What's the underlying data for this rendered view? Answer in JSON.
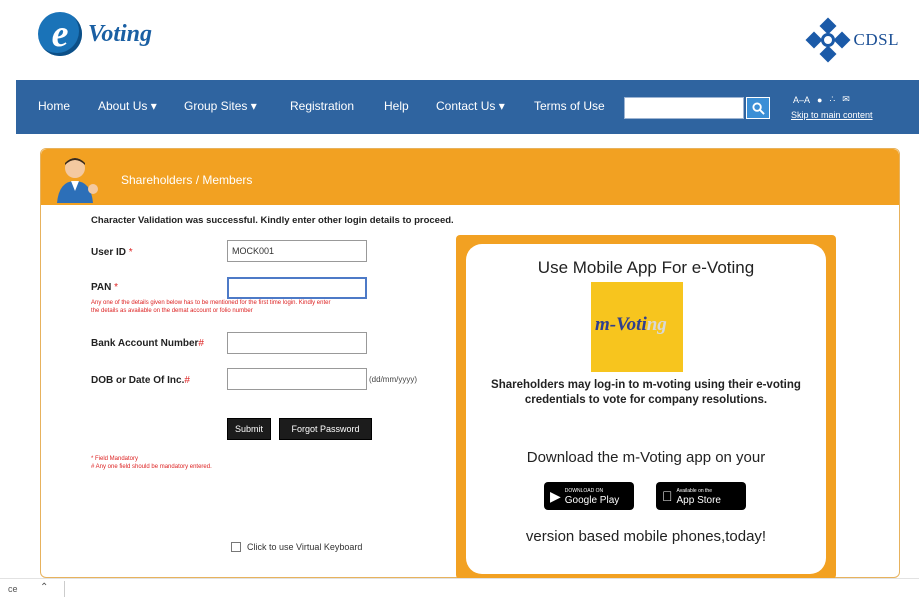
{
  "header": {
    "logo_letter": "e",
    "logo_text": "Voting",
    "partner_logo_text": "CDSL"
  },
  "nav": {
    "items": [
      {
        "label": "Home"
      },
      {
        "label": "About Us ▾"
      },
      {
        "label": "Group Sites ▾"
      },
      {
        "label": "Registration"
      },
      {
        "label": "Help"
      },
      {
        "label": "Contact Us ▾"
      },
      {
        "label": "Terms of Use"
      }
    ],
    "search_value": "",
    "skip_link": "Skip to main content",
    "util_icons": [
      "text-size-icon",
      "contrast-icon",
      "sitemap-icon",
      "mail-icon"
    ]
  },
  "panel": {
    "title": "Shareholders / Members",
    "validation_message": "Character Validation was successful. Kindly enter other login details to proceed.",
    "form": {
      "user_id_label": "User ID",
      "user_id_required": "*",
      "user_id_value": "MOCK001",
      "pan_label": "PAN",
      "pan_required": "*",
      "pan_value": "",
      "pan_note_line1": "Any one of the details given below has to be mentioned for the first time login. Kindly enter",
      "pan_note_line2": "the details as available on the demat account or folio number",
      "bank_label": "Bank Account Number",
      "bank_required": "#",
      "bank_value": "",
      "dob_label": "DOB or Date Of Inc.",
      "dob_required": "#",
      "dob_value": "",
      "dob_hint": "(dd/mm/yyyy)",
      "submit_label": "Submit",
      "forgot_label": "Forgot Password",
      "mandatory_note": "* Field Mandatory",
      "mandatory_note2": "# Any one field should be mandatory entered.",
      "virtual_keyboard_label": "Click to use Virtual Keyboard"
    },
    "mobile": {
      "title": "Use Mobile App For e-Voting",
      "logo_text": "m-Voti",
      "logo_fade": "ng",
      "description": "Shareholders may log-in to m-voting using their e-voting credentials to vote for company resolutions.",
      "download_text": "Download the m-Voting app on your",
      "google_small": "DOWNLOAD ON",
      "google_label": "Google Play",
      "apple_small": "Available on the",
      "apple_label": "App Store",
      "version_text": "version based mobile phones,today!"
    }
  },
  "bottombar": {
    "text": "ce"
  },
  "colors": {
    "nav_bg": "#2f64a0",
    "panel_orange": "#f2a122",
    "required_red": "#d22222"
  }
}
